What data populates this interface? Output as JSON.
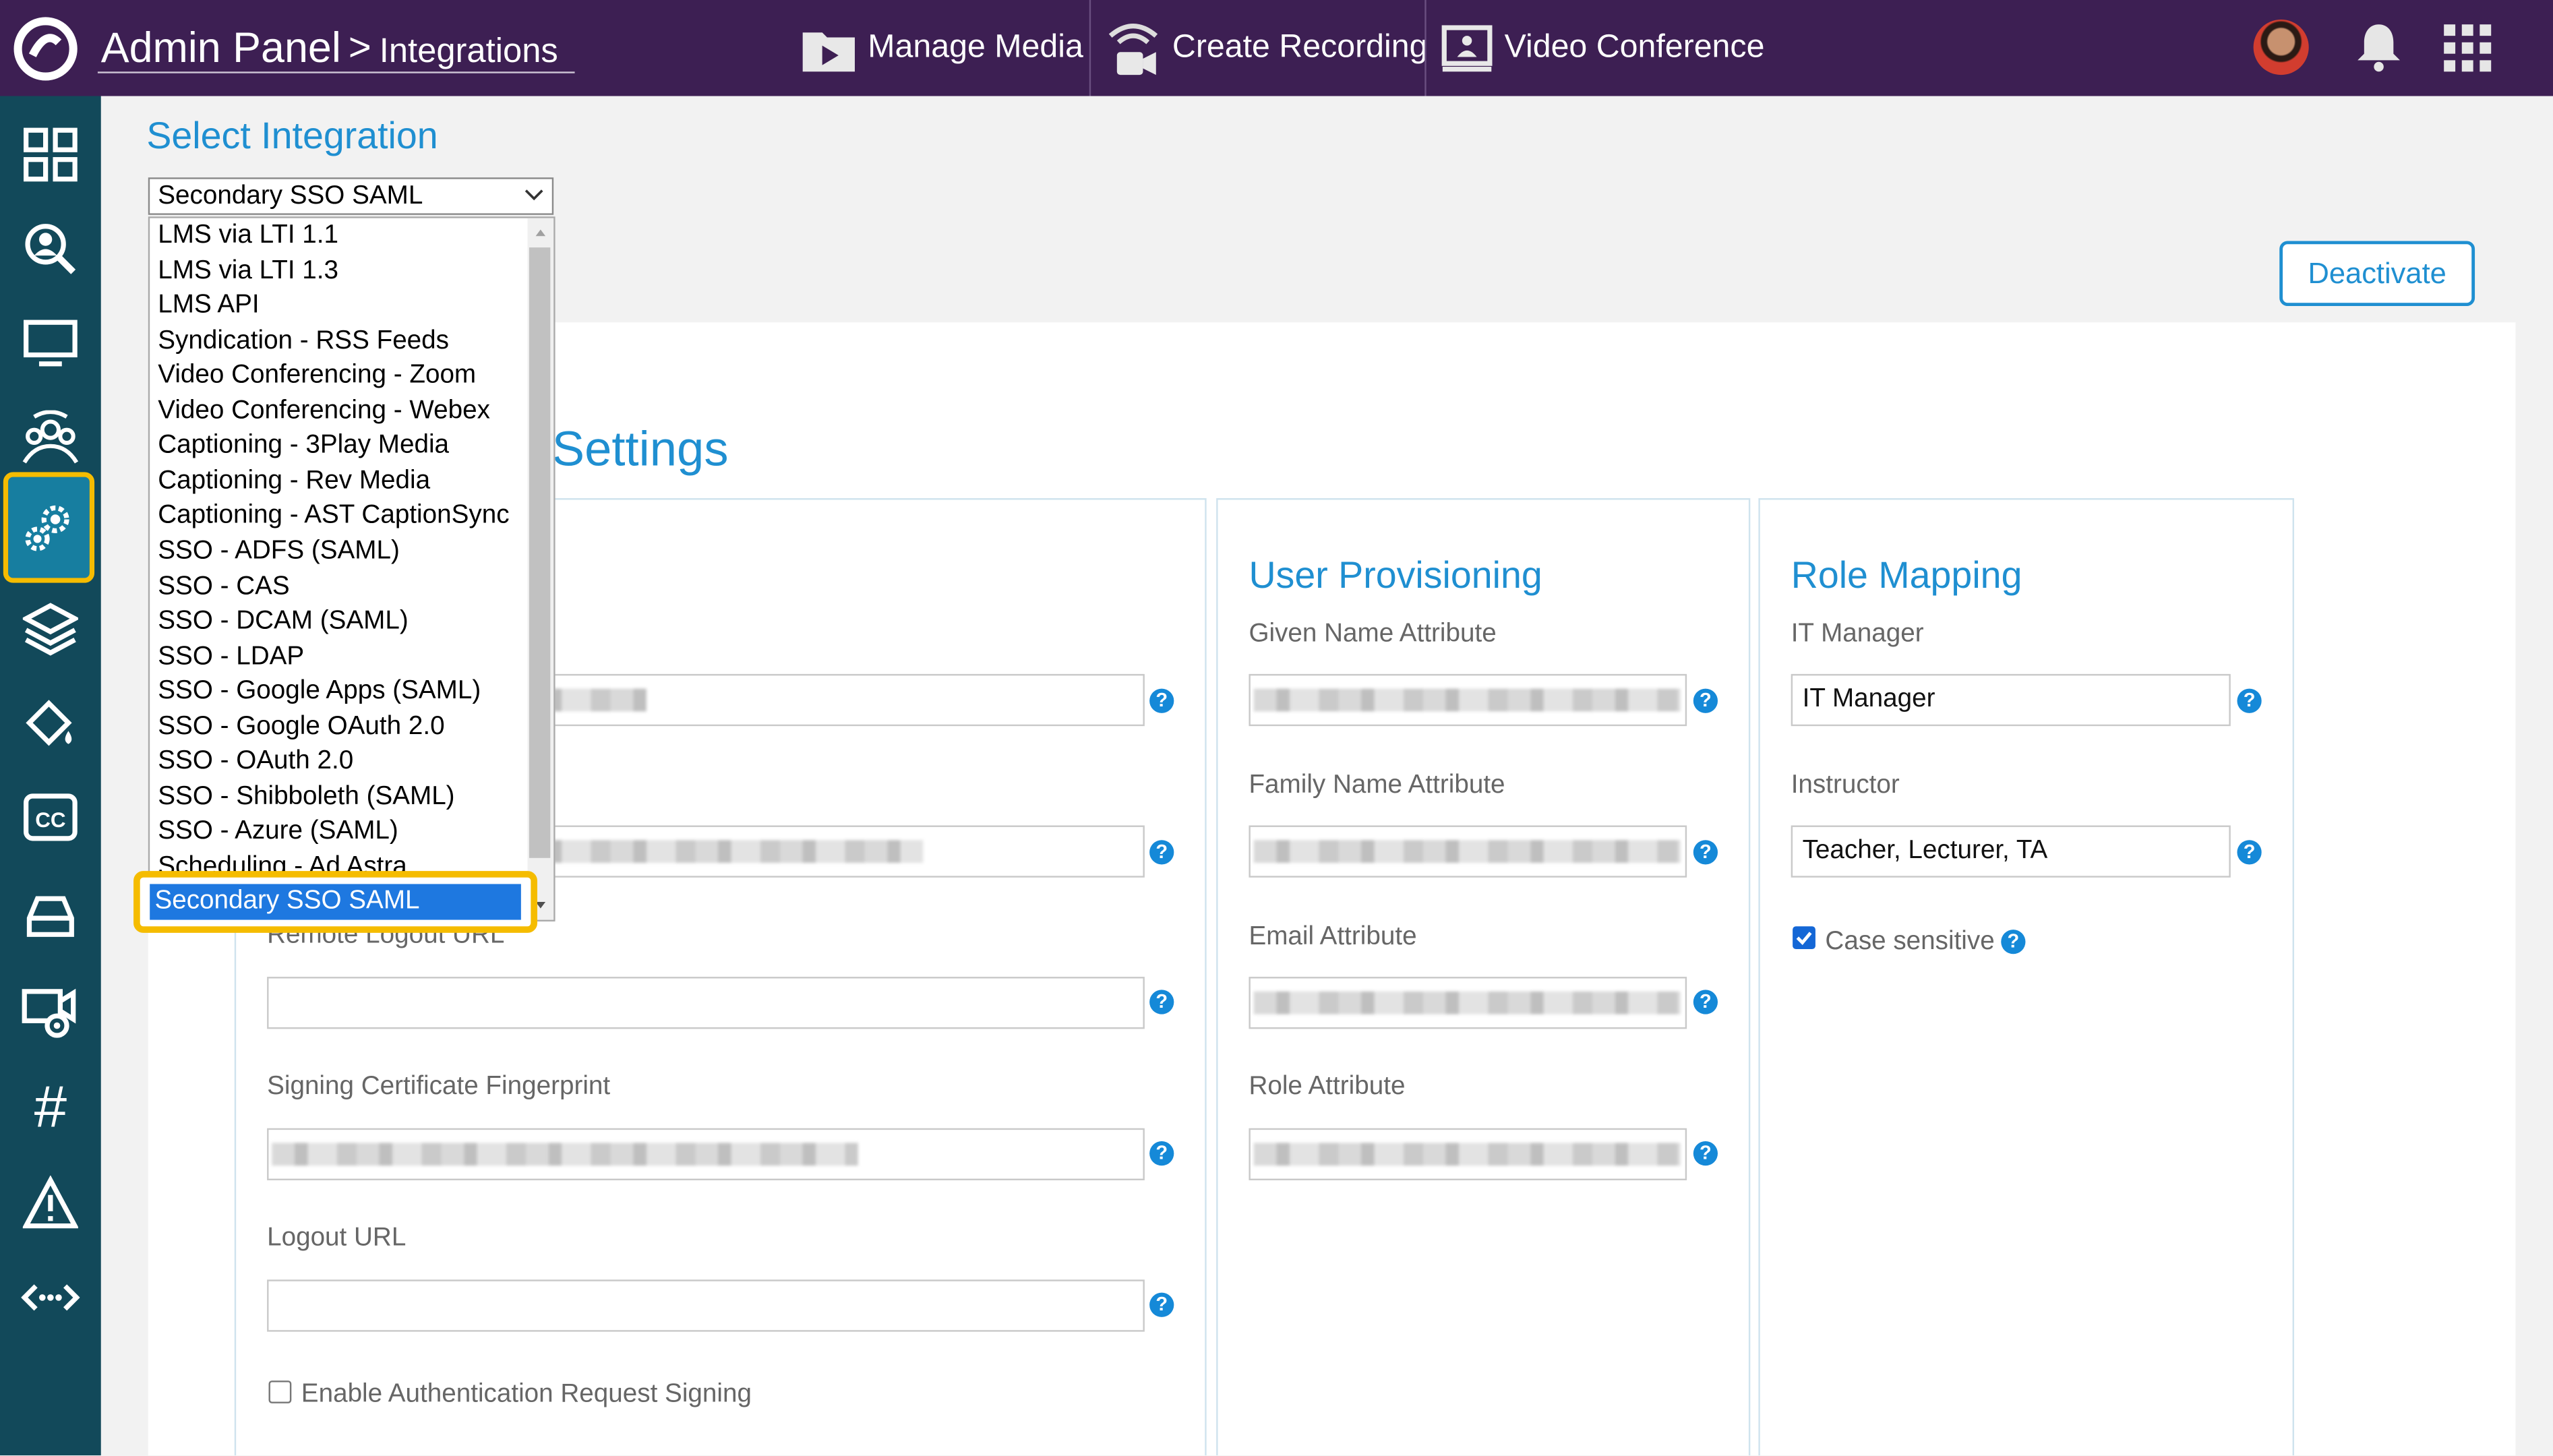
{
  "header": {
    "app_title": "Admin Panel",
    "separator": ">",
    "breadcrumb": "Integrations",
    "nav": [
      {
        "label": "Manage Media",
        "icon": "media-folder-icon"
      },
      {
        "label": "Create Recording",
        "icon": "recording-icon"
      },
      {
        "label": "Video Conference",
        "icon": "video-conference-icon"
      }
    ]
  },
  "sidebar": {
    "items": [
      {
        "icon": "dashboard-grid-icon"
      },
      {
        "icon": "search-users-icon"
      },
      {
        "icon": "monitor-icon"
      },
      {
        "icon": "audience-icon"
      },
      {
        "icon": "settings-gears-icon",
        "active": true
      },
      {
        "icon": "layers-icon"
      },
      {
        "icon": "paint-bucket-icon"
      },
      {
        "icon": "closed-captions-icon",
        "text": "CC"
      },
      {
        "icon": "drive-icon"
      },
      {
        "icon": "video-camera-icon"
      },
      {
        "icon": "hashtag-icon",
        "text": "#"
      },
      {
        "icon": "warning-icon"
      },
      {
        "icon": "api-arrows-icon"
      }
    ]
  },
  "main": {
    "section_title": "Select Integration",
    "selected_integration": "Secondary SSO SAML",
    "options": [
      "LMS via LTI 1.1",
      "LMS via LTI 1.3",
      "LMS API",
      "Syndication - RSS Feeds",
      "Video Conferencing - Zoom",
      "Video Conferencing - Webex",
      "Captioning - 3Play Media",
      "Captioning - Rev Media",
      "Captioning - AST CaptionSync",
      "SSO - ADFS (SAML)",
      "SSO - CAS",
      "SSO - DCAM (SAML)",
      "SSO - LDAP",
      "SSO - Google Apps (SAML)",
      "SSO - Google OAuth 2.0",
      "SSO - OAuth 2.0",
      "SSO - Shibboleth (SAML)",
      "SSO - Azure (SAML)",
      "Scheduling - Ad Astra"
    ],
    "highlighted_option": "Secondary SSO SAML",
    "deactivate_label": "Deactivate",
    "settings_heading": "Settings",
    "sso": {
      "remote_logout_label": "Remote Logout URL",
      "remote_logout_value": "",
      "signing_fingerprint_label": "Signing Certificate Fingerprint",
      "logout_url_label": "Logout URL",
      "logout_url_value": "",
      "enable_signing_label": "Enable Authentication Request Signing",
      "enable_signing_checked": false
    },
    "user_provisioning": {
      "title": "User Provisioning",
      "given_name_label": "Given Name Attribute",
      "family_name_label": "Family Name Attribute",
      "email_label": "Email Attribute",
      "role_label": "Role Attribute"
    },
    "role_mapping": {
      "title": "Role Mapping",
      "it_manager_label": "IT Manager",
      "it_manager_value": "IT Manager",
      "instructor_label": "Instructor",
      "instructor_value": "Teacher, Lecturer, TA",
      "case_sensitive_label": "Case sensitive",
      "case_sensitive_checked": true
    },
    "help_glyph": "?"
  },
  "colors": {
    "header_bg": "#3d1f53",
    "sidebar_bg": "#12495a",
    "accent": "#1f8fd1",
    "highlight": "#f5bc00",
    "selected_option_bg": "#1e78e0"
  }
}
